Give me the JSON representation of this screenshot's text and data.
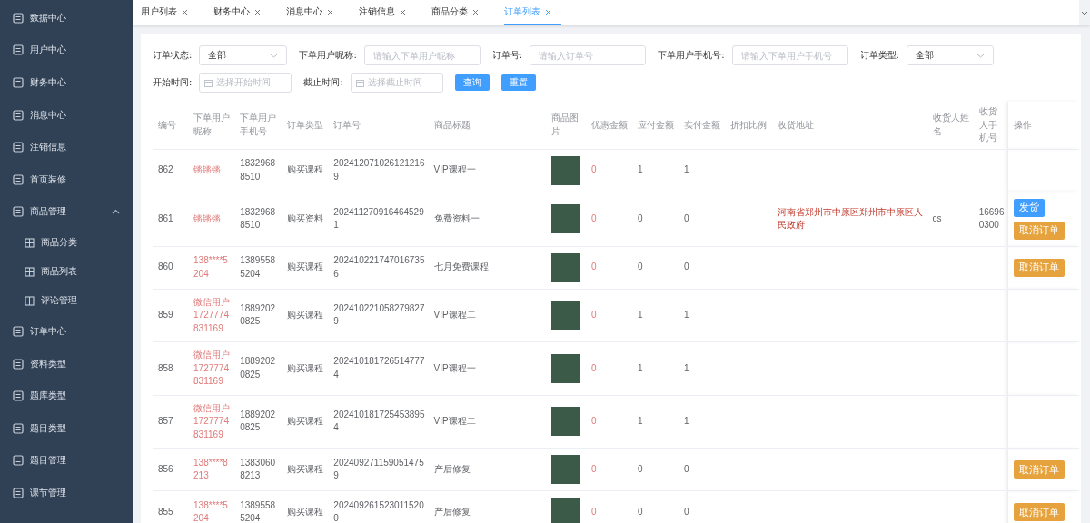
{
  "sidebar": {
    "items": [
      {
        "label": "数据中心"
      },
      {
        "label": "用户中心"
      },
      {
        "label": "财务中心"
      },
      {
        "label": "消息中心"
      },
      {
        "label": "注销信息"
      },
      {
        "label": "首页装修"
      },
      {
        "label": "商品管理",
        "expanded": true,
        "children": [
          {
            "label": "商品分类"
          },
          {
            "label": "商品列表"
          },
          {
            "label": "评论管理"
          }
        ]
      },
      {
        "label": "订单中心"
      },
      {
        "label": "资料类型"
      },
      {
        "label": "题库类型"
      },
      {
        "label": "题目类型"
      },
      {
        "label": "题目管理"
      },
      {
        "label": "课节管理"
      }
    ]
  },
  "tabs": [
    {
      "label": "用户列表",
      "selected": false
    },
    {
      "label": "财务中心",
      "selected": false
    },
    {
      "label": "消息中心",
      "selected": false
    },
    {
      "label": "注销信息",
      "selected": false
    },
    {
      "label": "商品分类",
      "selected": false
    },
    {
      "label": "订单列表",
      "selected": true
    }
  ],
  "filters": [
    {
      "kind": "select",
      "label": "订单状态:",
      "value": "全部"
    },
    {
      "kind": "input",
      "label": "下单用户昵称:",
      "placeholder": "请输入下单用户昵称"
    },
    {
      "kind": "input",
      "label": "订单号:",
      "placeholder": "请输入订单号"
    },
    {
      "kind": "input",
      "label": "下单用户手机号:",
      "placeholder": "请输入下单用户手机号"
    },
    {
      "kind": "select",
      "label": "订单类型:",
      "value": "全部"
    },
    {
      "kind": "date",
      "label": "开始时间:",
      "placeholder": "选择开始时间"
    },
    {
      "kind": "date",
      "label": "截止时间:",
      "placeholder": "选择截止时间"
    }
  ],
  "filter_buttons": [
    "查询",
    "重置"
  ],
  "table": {
    "columns": [
      "编号",
      "下单用户昵称",
      "下单用户手机号",
      "订单类型",
      "订单号",
      "商品标题",
      "商品图片",
      "优惠金额",
      "应付金额",
      "实付金额",
      "折扣比例",
      "收货地址",
      "收货人姓名",
      "收货人手机号",
      "操作"
    ],
    "rows": [
      {
        "id": "862",
        "nickname": "锵锵锵",
        "phone": "18329688510",
        "type": "购买课程",
        "order_no": "2024120710261212169",
        "title": "VIP课程一",
        "discount": "0",
        "payable": "1",
        "paid": "1"
      },
      {
        "id": "861",
        "nickname": "锵锵锵",
        "phone": "18329688510",
        "type": "购买资料",
        "order_no": "2024112709164645291",
        "title": "免费资料一",
        "discount": "0",
        "payable": "0",
        "paid": "0",
        "address": "河南省郑州市中原区郑州市中原区人民政府",
        "receiver": "cs",
        "receiver_phone": "166960300",
        "actions": [
          {
            "kind": "ship",
            "label": "发货"
          },
          {
            "kind": "cancel",
            "label": "取消订单"
          }
        ]
      },
      {
        "id": "860",
        "nickname": "138****5204",
        "phone": "13895585204",
        "type": "购买课程",
        "order_no": "2024102217470167356",
        "title": "七月免费课程",
        "discount": "0",
        "payable": "0",
        "paid": "0",
        "actions": [
          {
            "kind": "cancel",
            "label": "取消订单"
          }
        ]
      },
      {
        "id": "859",
        "nickname": "微信用户1727774831169",
        "phone": "18892020825",
        "type": "购买课程",
        "order_no": "2024102210582798279",
        "title": "VIP课程二",
        "discount": "0",
        "payable": "1",
        "paid": "1"
      },
      {
        "id": "858",
        "nickname": "微信用户1727774831169",
        "phone": "18892020825",
        "type": "购买课程",
        "order_no": "2024101817265147774",
        "title": "VIP课程一",
        "discount": "0",
        "payable": "1",
        "paid": "1"
      },
      {
        "id": "857",
        "nickname": "微信用户1727774831169",
        "phone": "18892020825",
        "type": "购买课程",
        "order_no": "2024101817254538954",
        "title": "VIP课程二",
        "discount": "0",
        "payable": "1",
        "paid": "1"
      },
      {
        "id": "856",
        "nickname": "138****8213",
        "phone": "13830608213",
        "type": "购买课程",
        "order_no": "2024092711590514759",
        "title": "产后修复",
        "discount": "0",
        "payable": "0",
        "paid": "0",
        "actions": [
          {
            "kind": "cancel",
            "label": "取消订单"
          }
        ]
      },
      {
        "id": "855",
        "nickname": "138****5204",
        "phone": "13895585204",
        "type": "购买课程",
        "order_no": "2024092615230115200",
        "title": "产后修复",
        "discount": "0",
        "payable": "0",
        "paid": "0",
        "actions": [
          {
            "kind": "cancel",
            "label": "取消订单"
          }
        ]
      }
    ]
  }
}
